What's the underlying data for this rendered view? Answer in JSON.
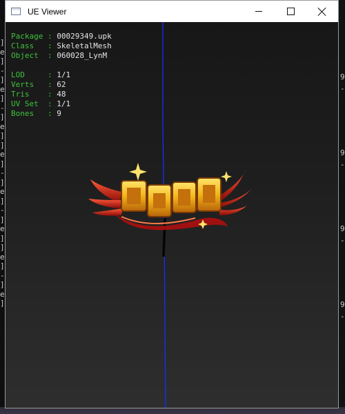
{
  "window": {
    "title": "UE Viewer"
  },
  "info": {
    "rows_top": [
      {
        "key": "Package",
        "value": "00029349.upk"
      },
      {
        "key": "Class  ",
        "value": "SkeletalMesh"
      },
      {
        "key": "Object ",
        "value": "060028_LynM"
      }
    ],
    "rows_bottom": [
      {
        "key": "LOD    ",
        "value": "1/1"
      },
      {
        "key": "Verts  ",
        "value": "62"
      },
      {
        "key": "Tris   ",
        "value": "48"
      },
      {
        "key": "UV Set ",
        "value": "1/1"
      },
      {
        "key": "Bones  ",
        "value": "9"
      }
    ]
  },
  "icons": {
    "app": "window-app-icon",
    "minimize": "minimize-icon",
    "maximize": "maximize-icon",
    "close": "close-icon"
  },
  "colors": {
    "label_green": "#3ec23e",
    "value_white": "#e6e6e6",
    "axis_blue": "#1a2cff",
    "logo_gold": "#f2c01f",
    "wing_red": "#c81a12"
  },
  "background_app": {
    "left_fragments": [
      "]",
      "e",
      "]",
      "-",
      "]",
      "e",
      "]",
      "-",
      "]",
      "e",
      "]",
      "]",
      "e",
      "]",
      "-",
      "]",
      "e",
      "]",
      "-",
      "]",
      "e",
      "]",
      "]",
      "e",
      "]",
      "-",
      "]",
      "e",
      "]"
    ],
    "right_fragments": [
      "9",
      "-",
      "9",
      "-",
      "9",
      "-",
      "9",
      "-"
    ]
  }
}
